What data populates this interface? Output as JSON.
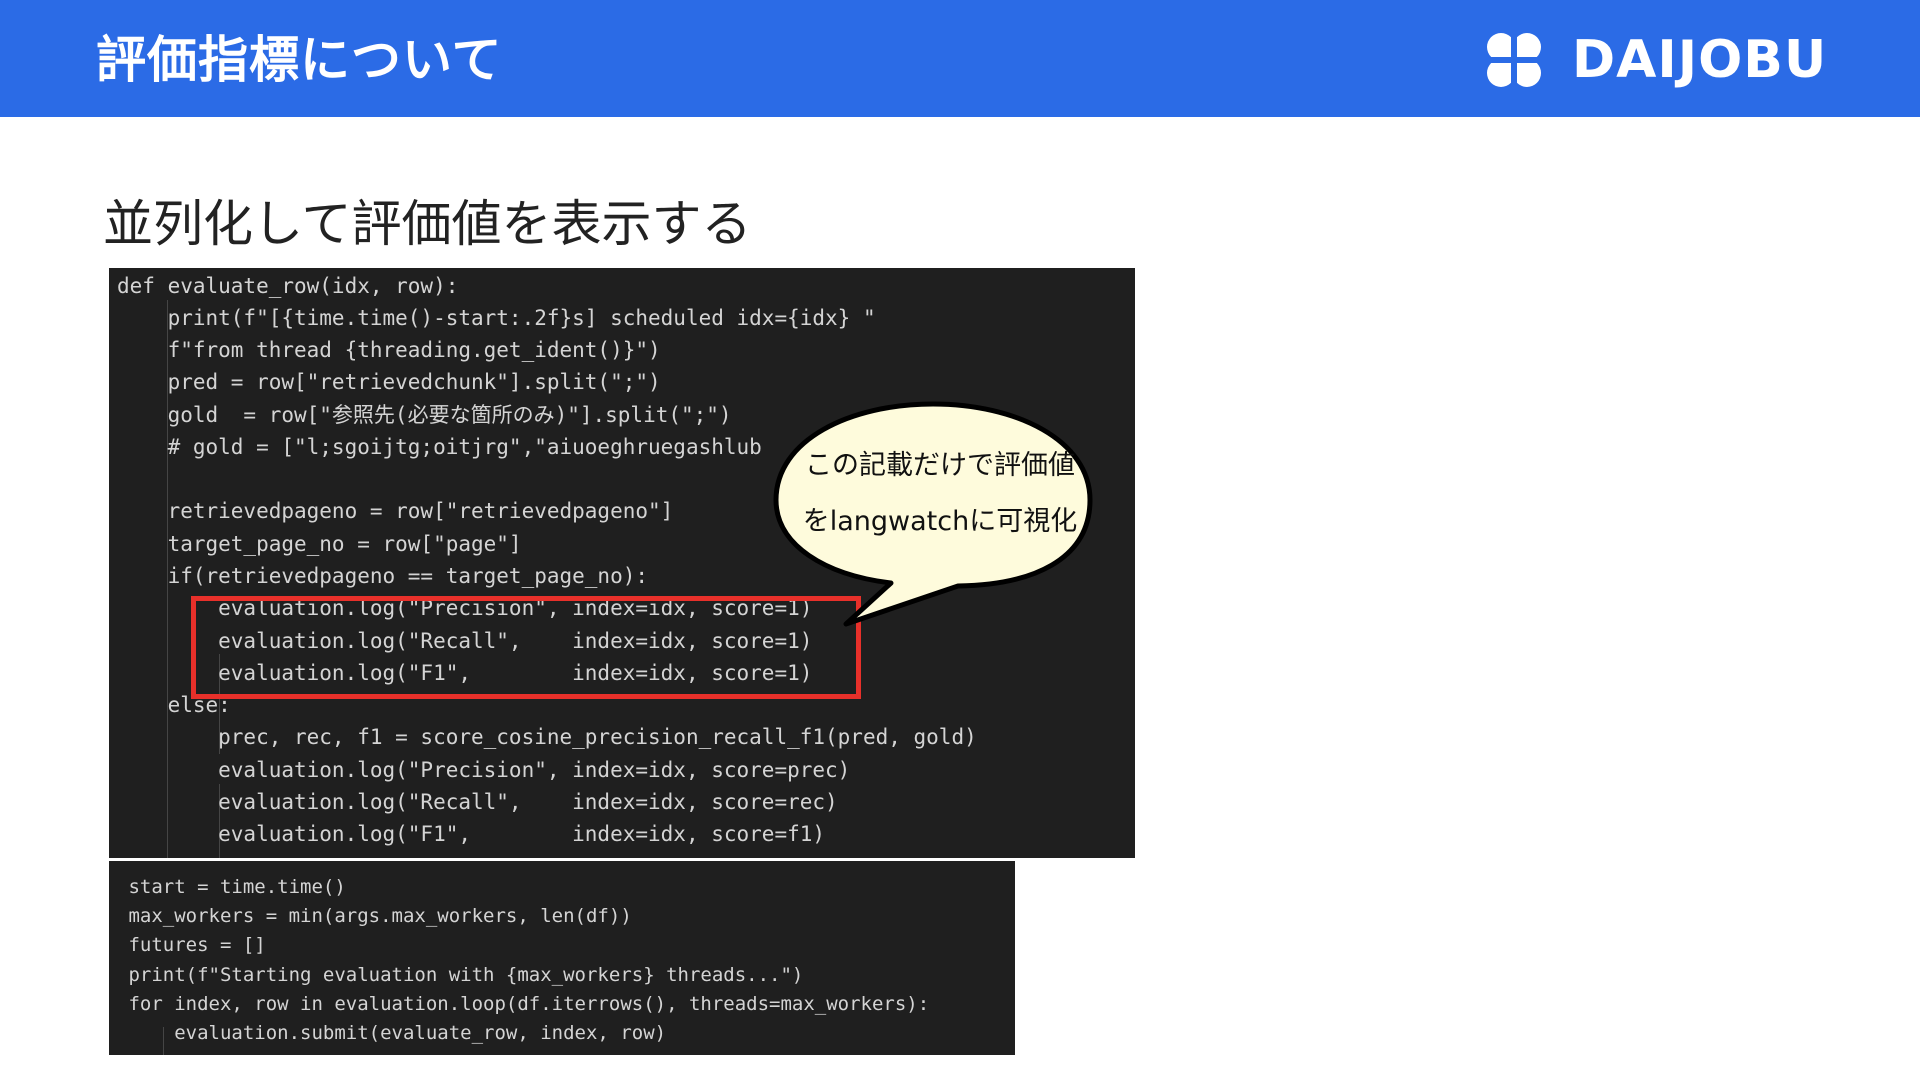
{
  "header": {
    "title": "評価指標について",
    "logo_text": "DAIJOBU",
    "logo_icon": "daijobu-logo-icon",
    "background_color": "#2b6be6"
  },
  "slide": {
    "subtitle": "並列化して評価値を表示する"
  },
  "callout": {
    "line1": "この記載だけで評価値",
    "line2": "をlangwatchに可視化"
  },
  "code_block_1": {
    "lines": [
      "def evaluate_row(idx, row):",
      "    print(f\"[{time.time()-start:.2f}s] scheduled idx={idx} \"",
      "    f\"from thread {threading.get_ident()}\")",
      "    pred = row[\"retrievedchunk\"].split(\";\")",
      "    gold  = row[\"参照先(必要な箇所のみ)\"].split(\";\")",
      "    # gold = [\"l;sgoijtg;oitjrg\",\"aiuoeghruegashlub",
      "",
      "    retrievedpageno = row[\"retrievedpageno\"]",
      "    target_page_no = row[\"page\"]",
      "    if(retrievedpageno == target_page_no):",
      "        evaluation.log(\"Precision\", index=idx, score=1)",
      "        evaluation.log(\"Recall\",    index=idx, score=1)",
      "        evaluation.log(\"F1\",        index=idx, score=1)",
      "    else:",
      "        prec, rec, f1 = score_cosine_precision_recall_f1(pred, gold)",
      "        evaluation.log(\"Precision\", index=idx, score=prec)",
      "        evaluation.log(\"Recall\",    index=idx, score=rec)",
      "        evaluation.log(\"F1\",        index=idx, score=f1)"
    ]
  },
  "code_block_2": {
    "lines": [
      " start = time.time()",
      " max_workers = min(args.max_workers, len(df))",
      " futures = []",
      " print(f\"Starting evaluation with {max_workers} threads...\")",
      " for index, row in evaluation.loop(df.iterrows(), threads=max_workers):",
      "     evaluation.submit(evaluate_row, index, row)"
    ]
  },
  "colors": {
    "highlight_border": "#e8302a",
    "callout_fill": "#fefbdc",
    "code_background": "#1f1f1f"
  }
}
